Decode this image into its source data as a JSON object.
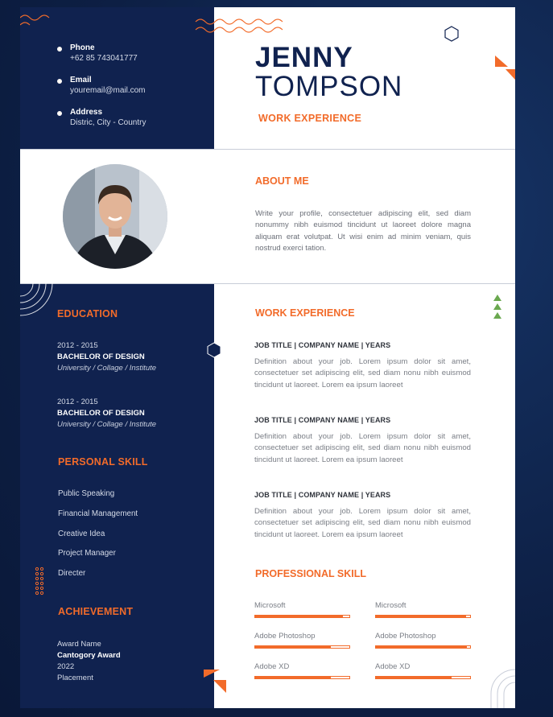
{
  "header": {
    "first_name": "JENNY",
    "last_name": "TOMPSON",
    "subtitle": "WORK EXPERIENCE"
  },
  "contact": [
    {
      "label": "Phone",
      "value": "+62 85 743041777"
    },
    {
      "label": "Email",
      "value": "youremail@mail.com"
    },
    {
      "label": "Address",
      "value": "Distric, City - Country"
    }
  ],
  "about": {
    "title": "ABOUT ME",
    "text": "Write your profile, consectetuer adipiscing elit, sed diam nonummy nibh euismod tincidunt ut laoreet dolore magna aliquam erat volutpat. Ut wisi enim ad minim veniam, quis nostrud exerci tation."
  },
  "education": {
    "title": "EDUCATION",
    "items": [
      {
        "years": "2012 - 2015",
        "degree": "BACHELOR OF DESIGN",
        "institution": "University / Collage / Institute"
      },
      {
        "years": "2012 - 2015",
        "degree": "BACHELOR OF DESIGN",
        "institution": "University / Collage / Institute"
      }
    ]
  },
  "personal_skill": {
    "title": "PERSONAL SKILL",
    "items": [
      "Public Speaking",
      "Financial Management",
      "Creative Idea",
      "Project Manager",
      "Directer"
    ]
  },
  "achievement": {
    "title": "ACHIEVEMENT",
    "award_name": "Award Name",
    "category": "Cantogory Award",
    "year": "2022",
    "placement": "Placement"
  },
  "work_experience": {
    "title": "WORK EXPERIENCE",
    "jobs": [
      {
        "title": "JOB TITLE | COMPANY NAME | YEARS",
        "description": "Definition about your job. Lorem ipsum dolor sit amet, consectetuer set adipiscing elit, sed diam nonu nibh euismod tincidunt ut laoreet. Lorem ea ipsum laoreet"
      },
      {
        "title": "JOB TITLE | COMPANY NAME | YEARS",
        "description": "Definition about your job. Lorem ipsum dolor sit amet, consectetuer set adipiscing elit, sed diam nonu nibh euismod tincidunt ut laoreet. Lorem ea ipsum laoreet"
      },
      {
        "title": "JOB TITLE | COMPANY NAME | YEARS",
        "description": "Definition about your job. Lorem ipsum dolor sit amet, consectetuer set adipiscing elit, sed diam nonu nibh euismod tincidunt ut laoreet. Lorem ea ipsum laoreet"
      }
    ]
  },
  "professional_skill": {
    "title": "PROFESSIONAL SKILL",
    "items": [
      {
        "label": "Microsoft",
        "level": 0.93
      },
      {
        "label": "Microsoft",
        "level": 0.96
      },
      {
        "label": "Adobe Photoshop",
        "level": 0.8
      },
      {
        "label": "Adobe Photoshop",
        "level": 0.97
      },
      {
        "label": "Adobe XD",
        "level": 0.8
      },
      {
        "label": "Adobe XD",
        "level": 0.8
      }
    ]
  },
  "colors": {
    "accent": "#f26b2a",
    "navy": "#10224f",
    "green": "#6aa84f"
  }
}
